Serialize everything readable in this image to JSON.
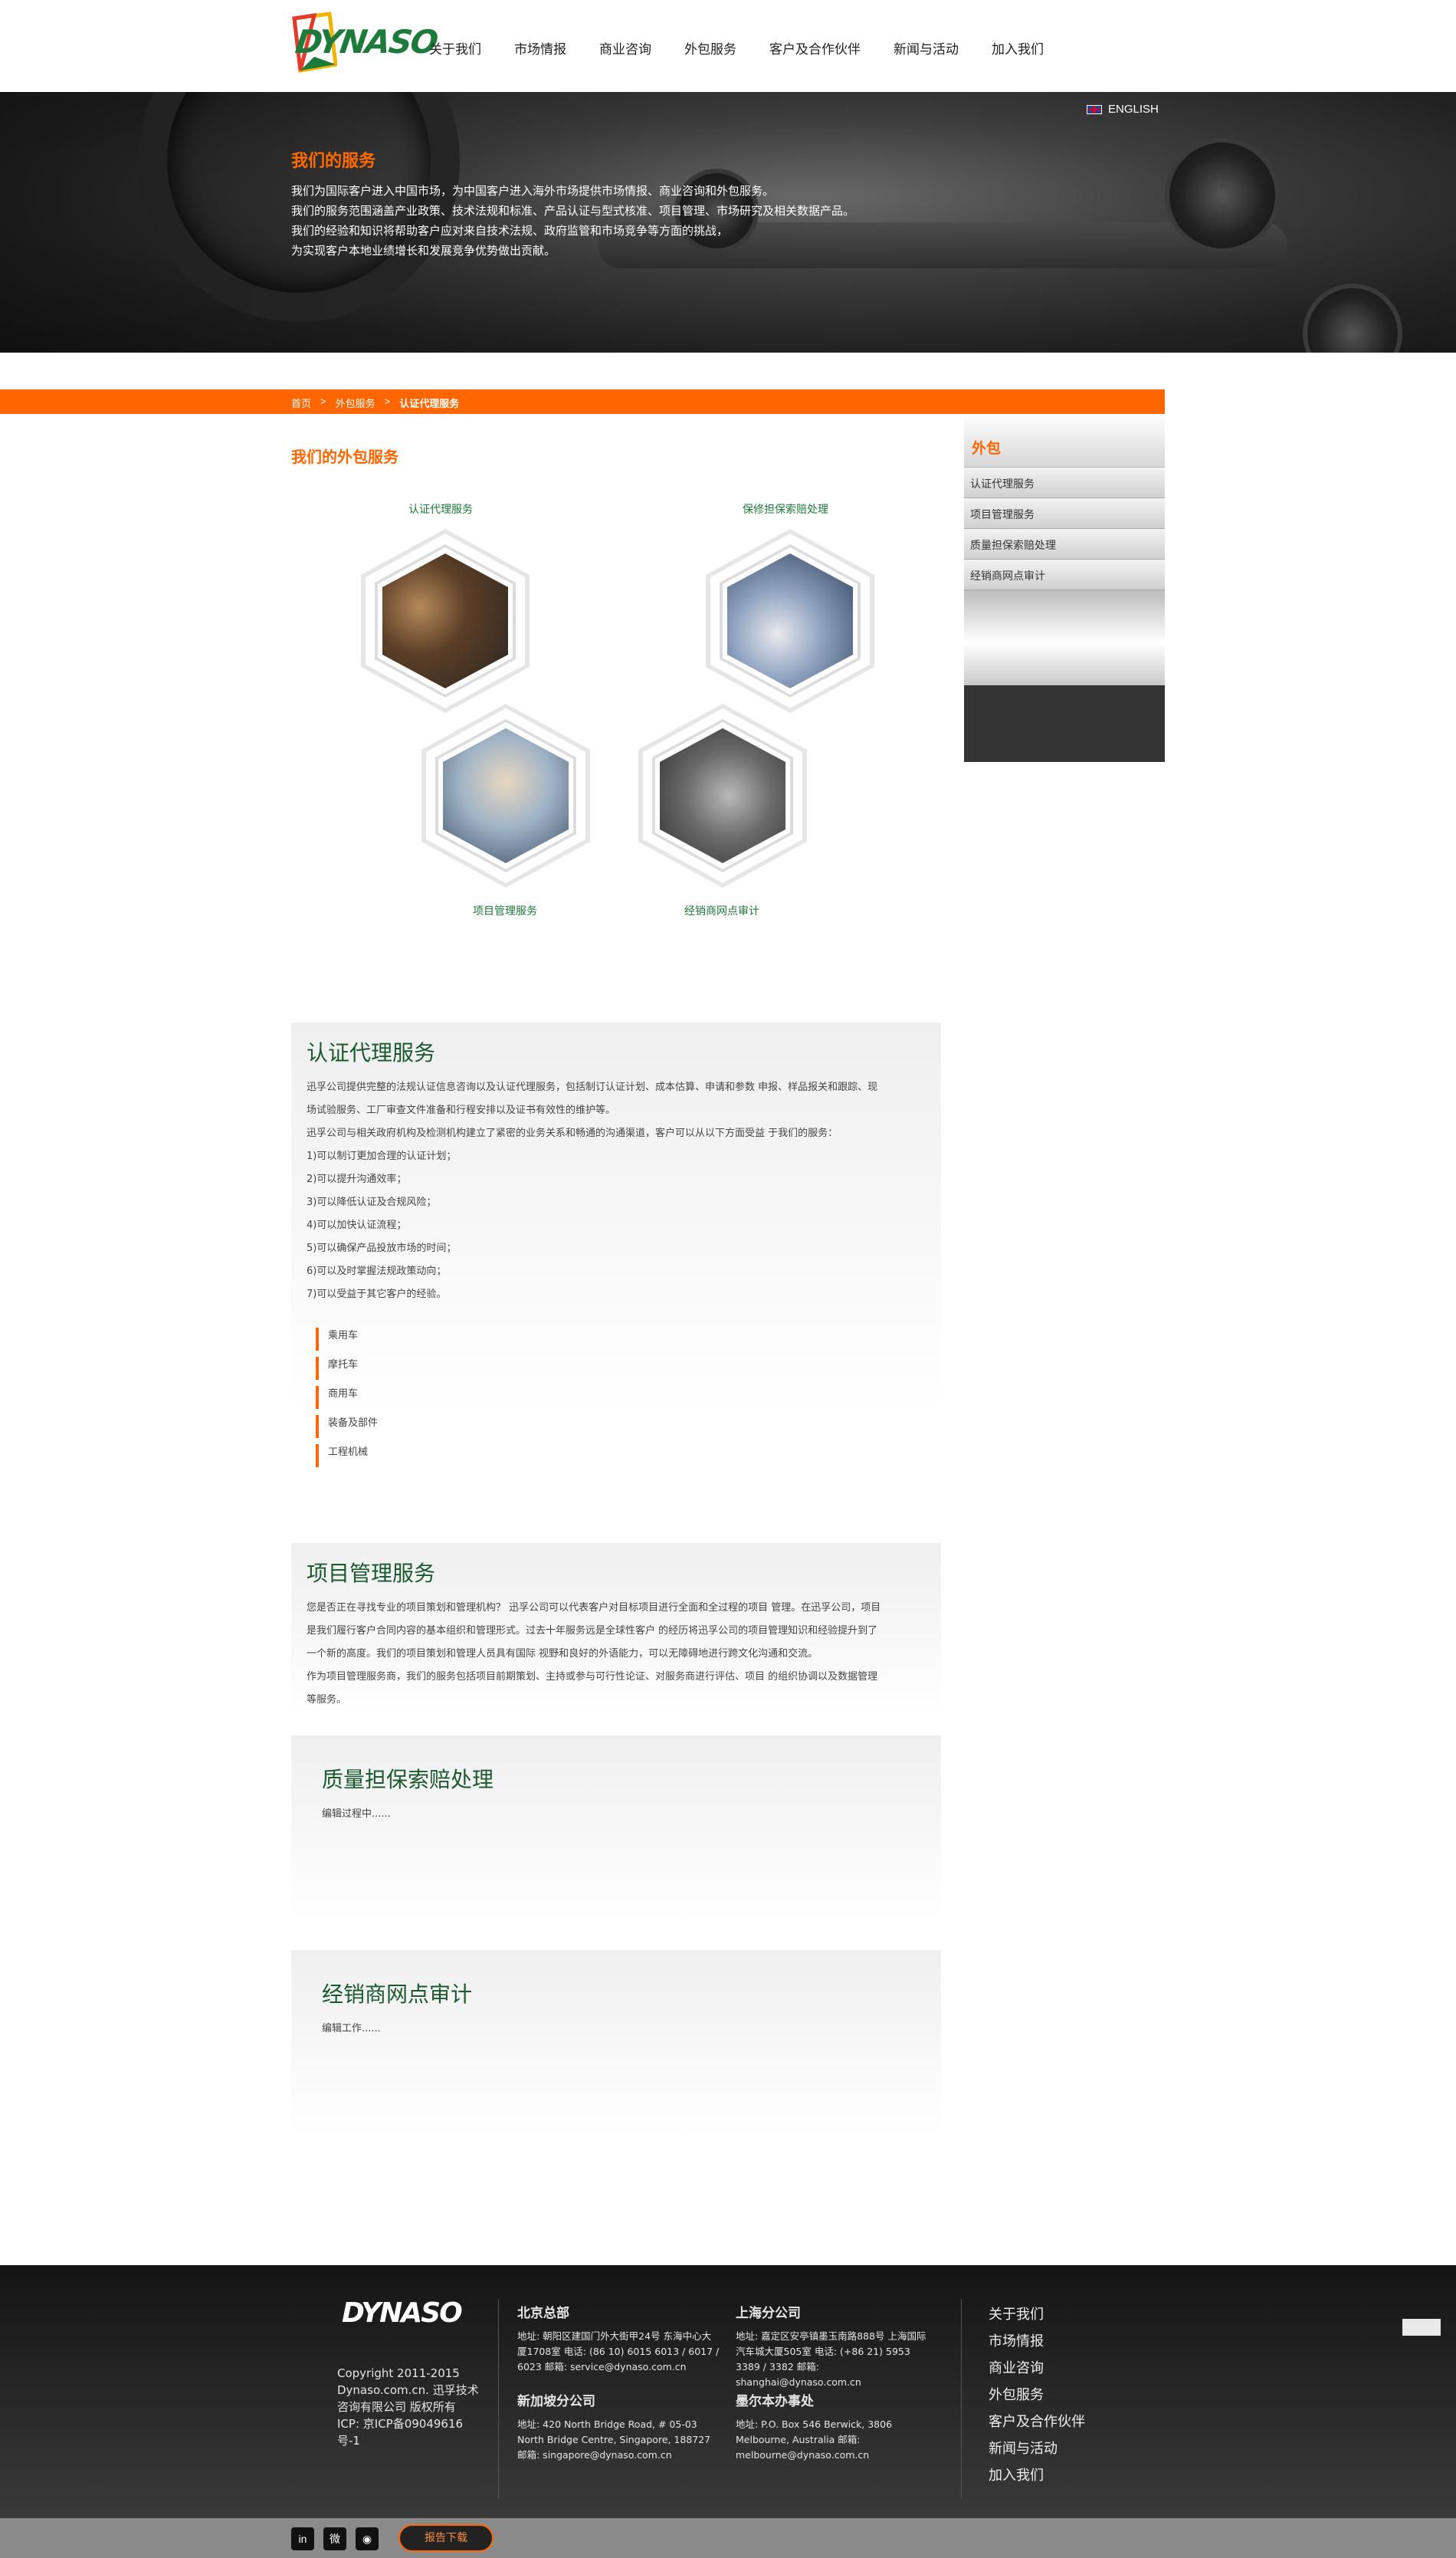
{
  "header": {
    "logo_text": "DYNASO",
    "nav": [
      "关于我们",
      "市场情报",
      "商业咨询",
      "外包服务",
      "客户及合作伙伴",
      "新闻与活动",
      "加入我们"
    ]
  },
  "banner": {
    "english_label": "ENGLISH",
    "title": "我们的服务",
    "lines": [
      "我们为国际客户进入中国市场，为中国客户进入海外市场提供市场情报、商业咨询和外包服务。",
      "我们的服务范围涵盖产业政策、技术法规和标准、产品认证与型式核准、项目管理、市场研究及相关数据产品。",
      "我们的经验和知识将帮助客户应对来自技术法规、政府监管和市场竞争等方面的挑战，",
      "为实现客户本地业绩增长和发展竞争优势做出贡献。"
    ]
  },
  "breadcrumb": {
    "home": "首页",
    "sep": ">",
    "parent": "外包服务",
    "current": "认证代理服务"
  },
  "section_title": "我们的外包服务",
  "services": {
    "s1": "认证代理服务",
    "s2": "保修担保索赔处理",
    "s3": "项目管理服务",
    "s4": "经销商网点审计"
  },
  "sidebar": {
    "title": "外包",
    "items": [
      "认证代理服务",
      "项目管理服务",
      "质量担保索赔处理",
      "经销商网点审计"
    ]
  },
  "panel1": {
    "title": "认证代理服务",
    "paragraphs": [
      "迅孚公司提供完整的法规认证信息咨询以及认证代理服务，包括制订认证计划、成本估算、申请和参数 申报、样品报关和跟踪、现",
      "场试验服务、工厂审查文件准备和行程安排以及证书有效性的维护等。",
      "迅孚公司与相关政府机构及检测机构建立了紧密的业务关系和畅通的沟通渠道，客户可以从以下方面受益 于我们的服务：",
      "1)可以制订更加合理的认证计划；",
      "2)可以提升沟通效率；",
      "3)可以降低认证及合规风险；",
      "4)可以加快认证流程；",
      "5)可以确保产品投放市场的时间；",
      "6)可以及时掌握法规政策动向；",
      "7)可以受益于其它客户的经验。"
    ],
    "bullets": [
      "乘用车",
      "摩托车",
      "商用车",
      "装备及部件",
      "工程机械"
    ]
  },
  "panel2": {
    "title": "项目管理服务",
    "paragraphs": [
      "您是否正在寻找专业的项目策划和管理机构？ 迅孚公司可以代表客户对目标项目进行全面和全过程的项目 管理。在迅孚公司，项目",
      "是我们履行客户合同内容的基本组织和管理形式。过去十年服务远是全球性客户 的经历将迅孚公司的项目管理知识和经验提升到了",
      "一个新的高度。我们的项目策划和管理人员具有国际 视野和良好的外语能力，可以无障碍地进行跨文化沟通和交流。",
      "作为项目管理服务商，我们的服务包括项目前期策划、主持或参与可行性论证、对服务商进行评估、项目 的组织协调以及数据管理",
      "等服务。"
    ]
  },
  "panel3": {
    "title": "质量担保索赔处理",
    "text": "编辑过程中......"
  },
  "panel4": {
    "title": "经销商网点审计",
    "text": "编辑工作......"
  },
  "footer": {
    "logo_text": "DYNASO",
    "copyright": [
      "Copyright 2011-2015",
      "Dynaso.com.cn. 迅孚技术",
      "咨询有限公司 版权所有",
      "ICP: 京ICP备09049616",
      "号-1"
    ],
    "offices": [
      {
        "name": "北京总部",
        "detail": [
          "地址: 朝阳区建国门外大街甲24号 东海中心大",
          "厦1708室 电话: (86 10) 6015 6013 / 6017 /",
          "6023 邮箱: service@dynaso.com.cn"
        ]
      },
      {
        "name": "上海分公司",
        "detail": [
          "地址: 嘉定区安亭镇墨玉南路888号 上海国际",
          "汽车城大厦505室 电话: (+86 21) 5953",
          "3389 / 3382 邮箱:",
          "shanghai@dynaso.com.cn"
        ]
      },
      {
        "name": "新加坡分公司",
        "detail": [
          "地址: 420 North Bridge Road, # 05-03",
          "North Bridge Centre, Singapore, 188727",
          "邮箱: singapore@dynaso.com.cn"
        ]
      },
      {
        "name": "墨尔本办事处",
        "detail": [
          "地址: P.O. Box 546 Berwick, 3806",
          "Melbourne, Australia 邮箱:",
          "melbourne@dynaso.com.cn"
        ]
      }
    ],
    "links": [
      "关于我们",
      "市场情报",
      "商业咨询",
      "外包服务",
      "客户及合作伙伴",
      "新闻与活动",
      "加入我们"
    ]
  },
  "bottom": {
    "social": [
      "in",
      "微",
      "◉"
    ],
    "download_label": "报告下载"
  },
  "colors": {
    "accent": "#ff6600",
    "green": "#1e7a3a",
    "footer": "#2a2a2a"
  }
}
